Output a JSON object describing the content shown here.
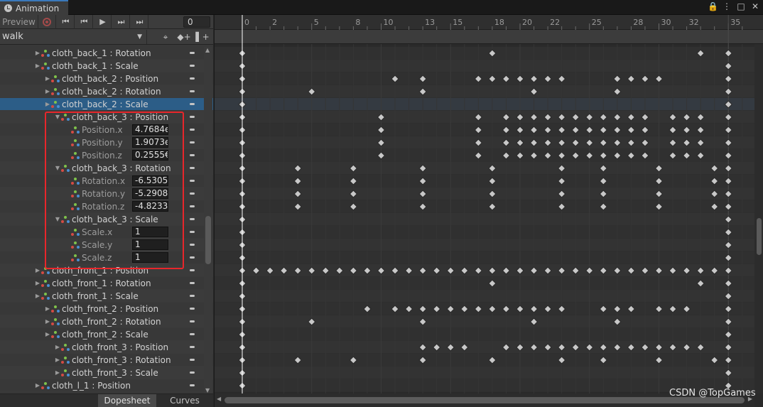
{
  "window": {
    "tab_title": "Animation",
    "buttons": [
      "🔒",
      "⋮",
      "□",
      "✕"
    ]
  },
  "toolbar": {
    "preview_label": "Preview",
    "first_key": "⏮",
    "prev_key": "⏮",
    "play": "▶",
    "next_key": "⏭",
    "last_key": "⏭",
    "frame": "0"
  },
  "clip": {
    "name": "walk",
    "add_key": "◆+",
    "add_event": "▌+"
  },
  "ruler_labels": [
    "0",
    "2",
    "5",
    "8",
    "10",
    "13",
    "15",
    "18",
    "20",
    "22",
    "25",
    "28",
    "30",
    "32",
    "35"
  ],
  "properties": [
    {
      "label": "cloth_back_1 : Rotation",
      "indent": 1,
      "fold": "▶",
      "kind": "group",
      "keys": [
        0,
        18,
        33,
        35
      ]
    },
    {
      "label": "cloth_back_1 : Scale",
      "indent": 1,
      "fold": "▶",
      "kind": "group",
      "keys": [
        0,
        35
      ]
    },
    {
      "label": "cloth_back_2 : Position",
      "indent": 2,
      "fold": "▶",
      "kind": "group",
      "keys": [
        0,
        11,
        13,
        17,
        18,
        19,
        20,
        21,
        22,
        23,
        27,
        28,
        29,
        30,
        35
      ]
    },
    {
      "label": "cloth_back_2 : Rotation",
      "indent": 2,
      "fold": "▶",
      "kind": "group",
      "keys": [
        0,
        5,
        13,
        21,
        27,
        35
      ]
    },
    {
      "label": "cloth_back_2 : Scale",
      "indent": 2,
      "fold": "▶",
      "kind": "group",
      "keys": [
        0,
        35
      ],
      "selected": true
    },
    {
      "label": "cloth_back_3 : Position",
      "indent": 3,
      "fold": "▼",
      "kind": "group",
      "keys": [
        0,
        10,
        17,
        19,
        20,
        21,
        22,
        23,
        24,
        25,
        26,
        27,
        28,
        29,
        31,
        32,
        33,
        35
      ]
    },
    {
      "label": "Position.x",
      "indent": 4,
      "kind": "child",
      "value": "4.7684e",
      "keys": [
        0,
        10,
        17,
        19,
        20,
        21,
        22,
        23,
        24,
        25,
        26,
        27,
        28,
        29,
        31,
        32,
        33,
        35
      ]
    },
    {
      "label": "Position.y",
      "indent": 4,
      "kind": "child",
      "value": "1.9073e",
      "keys": [
        0,
        10,
        17,
        19,
        20,
        21,
        22,
        23,
        24,
        25,
        26,
        27,
        28,
        29,
        31,
        32,
        33,
        35
      ]
    },
    {
      "label": "Position.z",
      "indent": 4,
      "kind": "child",
      "value": "0.2555€",
      "keys": [
        0,
        10,
        17,
        19,
        20,
        21,
        22,
        23,
        24,
        25,
        26,
        27,
        28,
        29,
        31,
        32,
        33,
        35
      ]
    },
    {
      "label": "cloth_back_3 : Rotation",
      "indent": 3,
      "fold": "▼",
      "kind": "group",
      "keys": [
        0,
        4,
        8,
        13,
        18,
        23,
        26,
        30,
        34,
        35
      ]
    },
    {
      "label": "Rotation.x",
      "indent": 4,
      "kind": "child",
      "value": "-6.5305",
      "keys": [
        0,
        4,
        8,
        13,
        18,
        23,
        26,
        30,
        34,
        35
      ]
    },
    {
      "label": "Rotation.y",
      "indent": 4,
      "kind": "child",
      "value": "-5.2908",
      "keys": [
        0,
        4,
        8,
        13,
        18,
        23,
        26,
        30,
        34,
        35
      ]
    },
    {
      "label": "Rotation.z",
      "indent": 4,
      "kind": "child",
      "value": "-4.8233",
      "keys": [
        0,
        4,
        8,
        13,
        18,
        23,
        26,
        30,
        34,
        35
      ]
    },
    {
      "label": "cloth_back_3 : Scale",
      "indent": 3,
      "fold": "▼",
      "kind": "group",
      "keys": [
        0,
        35
      ]
    },
    {
      "label": "Scale.x",
      "indent": 4,
      "kind": "child",
      "value": "1",
      "keys": [
        0,
        35
      ]
    },
    {
      "label": "Scale.y",
      "indent": 4,
      "kind": "child",
      "value": "1",
      "keys": [
        0,
        35
      ]
    },
    {
      "label": "Scale.z",
      "indent": 4,
      "kind": "child",
      "value": "1",
      "keys": [
        0,
        35
      ]
    },
    {
      "label": "cloth_front_1 : Position",
      "indent": 1,
      "fold": "▶",
      "kind": "group",
      "keys": [
        0,
        1,
        2,
        3,
        4,
        5,
        6,
        7,
        8,
        9,
        10,
        11,
        12,
        13,
        14,
        15,
        16,
        17,
        18,
        19,
        20,
        21,
        22,
        23,
        24,
        25,
        26,
        27,
        28,
        29,
        30,
        31,
        32,
        33,
        34,
        35
      ]
    },
    {
      "label": "cloth_front_1 : Rotation",
      "indent": 1,
      "fold": "▶",
      "kind": "group",
      "keys": [
        0,
        18,
        33,
        35
      ]
    },
    {
      "label": "cloth_front_1 : Scale",
      "indent": 1,
      "fold": "▶",
      "kind": "group",
      "keys": [
        0,
        35
      ]
    },
    {
      "label": "cloth_front_2 : Position",
      "indent": 2,
      "fold": "▶",
      "kind": "group",
      "keys": [
        0,
        9,
        11,
        12,
        13,
        14,
        15,
        16,
        17,
        18,
        19,
        20,
        21,
        22,
        23,
        26,
        27,
        28,
        30,
        31,
        32,
        35
      ]
    },
    {
      "label": "cloth_front_2 : Rotation",
      "indent": 2,
      "fold": "▶",
      "kind": "group",
      "keys": [
        0,
        5,
        13,
        21,
        27,
        35
      ]
    },
    {
      "label": "cloth_front_2 : Scale",
      "indent": 2,
      "fold": "▶",
      "kind": "group",
      "keys": [
        0,
        35
      ]
    },
    {
      "label": "cloth_front_3 : Position",
      "indent": 3,
      "fold": "▶",
      "kind": "group",
      "keys": [
        0,
        13,
        14,
        15,
        16,
        19,
        20,
        21,
        22,
        23,
        24,
        25,
        26,
        27,
        28,
        29,
        30,
        31,
        32,
        33,
        35
      ]
    },
    {
      "label": "cloth_front_3 : Rotation",
      "indent": 3,
      "fold": "▶",
      "kind": "group",
      "keys": [
        0,
        4,
        8,
        13,
        18,
        23,
        26,
        30,
        34,
        35
      ]
    },
    {
      "label": "cloth_front_3 : Scale",
      "indent": 3,
      "fold": "▶",
      "kind": "group",
      "keys": [
        0,
        35
      ]
    },
    {
      "label": "cloth_l_1 : Position",
      "indent": 1,
      "fold": "▶",
      "kind": "group",
      "keys": [
        0,
        35
      ]
    }
  ],
  "bottom_tabs": {
    "dopesheet": "Dopesheet",
    "curves": "Curves"
  },
  "watermark": "CSDN @TopGames",
  "colors": {
    "selection": "#2c5d87",
    "highlight_box": "#e8262b",
    "key": "#c8c8c8"
  }
}
